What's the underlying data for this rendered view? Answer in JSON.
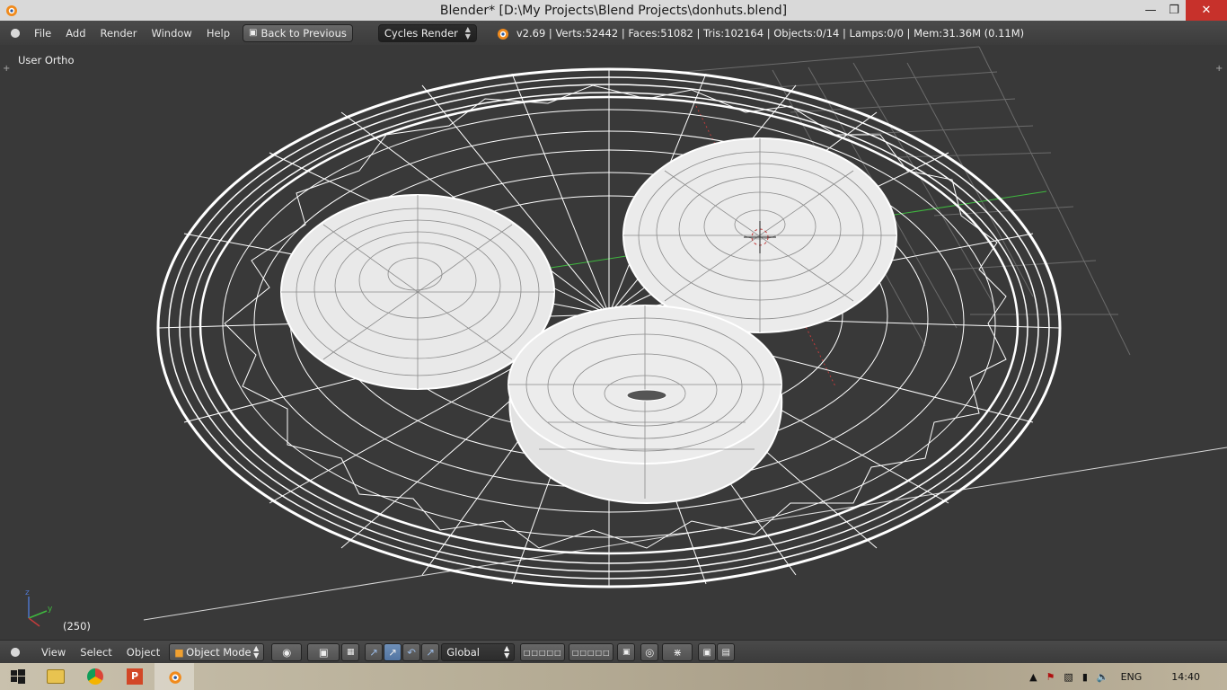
{
  "window": {
    "title": "Blender* [D:\\My Projects\\Blend Projects\\donhuts.blend]",
    "controls": [
      "minimize",
      "restore",
      "close"
    ]
  },
  "info_header": {
    "menus": [
      "File",
      "Add",
      "Render",
      "Window",
      "Help"
    ],
    "back_button": "Back to Previous",
    "render_engine": "Cycles Render",
    "stats": "v2.69 | Verts:52442 | Faces:51082 | Tris:102164 | Objects:0/14 | Lamps:0/0 | Mem:31.36M (0.11M)"
  },
  "viewport": {
    "view_name": "User Ortho",
    "frame": "(250)",
    "axis_colors": {
      "x": "#c23b3b",
      "y": "#3fb83f",
      "z": "#4e74c8"
    },
    "wire_color": "#ffffff",
    "background": "#393939"
  },
  "view_header": {
    "menus": [
      "View",
      "Select",
      "Object"
    ],
    "mode": "Object Mode",
    "orientation": "Global"
  },
  "taskbar": {
    "apps": [
      "start-icon",
      "file-explorer-icon",
      "chrome-icon",
      "powerpoint-icon",
      "blender-icon"
    ],
    "language": "ENG",
    "clock": "14:40"
  }
}
